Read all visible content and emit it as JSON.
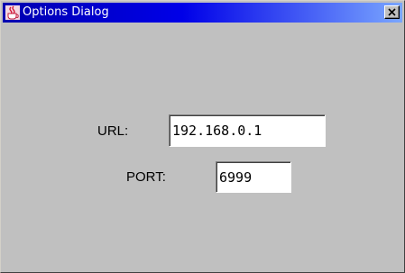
{
  "window": {
    "title": "Options Dialog",
    "icon": "java-cup-icon",
    "close_glyph": "✕"
  },
  "form": {
    "url": {
      "label": "URL:",
      "value": "192.168.0.1"
    },
    "port": {
      "label": "PORT:",
      "value": "6999"
    }
  },
  "colors": {
    "titlebar_start": "#0000b0",
    "titlebar_end": "#7aa6ff",
    "dialog_background": "#c0c0c0",
    "field_background": "#ffffff"
  }
}
